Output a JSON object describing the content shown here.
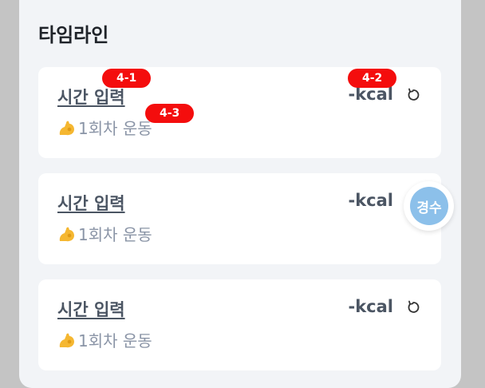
{
  "timeline": {
    "title": "타임라인",
    "entries": [
      {
        "time_label": "시간 입력",
        "kcal_label": "-kcal",
        "session_label": "1회차 운동"
      },
      {
        "time_label": "시간 입력",
        "kcal_label": "-kcal",
        "session_label": "1회차 운동"
      },
      {
        "time_label": "시간 입력",
        "kcal_label": "-kcal",
        "session_label": "1회차 운동"
      }
    ]
  },
  "badges": [
    "4-1",
    "4-2",
    "4-3"
  ],
  "floating_avatar": {
    "label": "경수",
    "color": "#8cc0ea"
  },
  "icons": {
    "reset": "reset-icon",
    "session": "flexed-biceps-icon"
  },
  "colors": {
    "badge": "#f40d0d",
    "background": "#f2f4f7",
    "card": "#ffffff"
  }
}
